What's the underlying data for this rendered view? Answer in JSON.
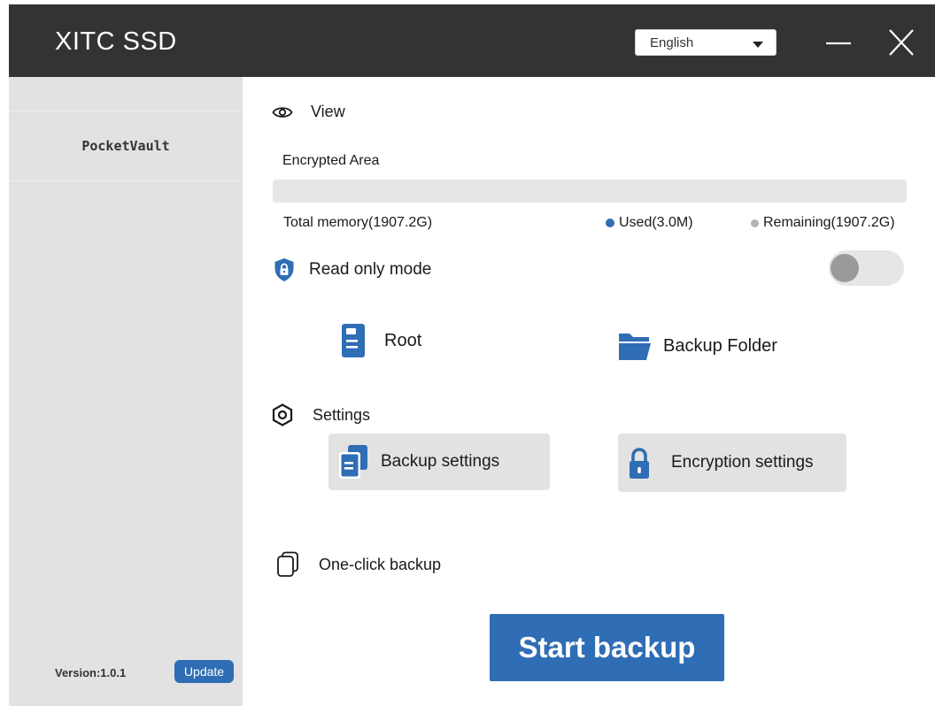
{
  "titlebar": {
    "title": "XITC SSD",
    "language": {
      "selected": "English"
    },
    "minimize_icon": "minimize-icon",
    "close_icon": "close-icon"
  },
  "sidebar": {
    "device_name": "PocketVault",
    "version": "Version:1.0.1",
    "update_label": "Update"
  },
  "view": {
    "heading": "View",
    "icon": "eye-icon",
    "area_label": "Encrypted Area",
    "used_fraction": 1.5e-06,
    "total_memory": "Total memory(1907.2G)",
    "used": "Used(3.0M)",
    "remaining": "Remaining(1907.2G)",
    "read_only_label": "Read only mode",
    "read_only_icon": "shield-lock-icon",
    "read_only_enabled": false,
    "root_label": "Root",
    "root_icon": "document-icon",
    "backup_folder_label": "Backup Folder",
    "backup_folder_icon": "folder-open-icon"
  },
  "settings": {
    "heading": "Settings",
    "icon": "hexagon-settings-icon",
    "backup_settings_label": "Backup settings",
    "backup_settings_icon": "copy-icon",
    "encryption_settings_label": "Encryption settings",
    "encryption_settings_icon": "lock-icon"
  },
  "backup": {
    "one_click_label": "One-click backup",
    "one_click_icon": "copy-outline-icon",
    "start_label": "Start backup"
  },
  "colors": {
    "accent": "#2f6db5",
    "titlebar": "#333333",
    "sidebar": "#e2e2e2",
    "used_dot": "#2f6db5",
    "remaining_dot": "#b3b3b3"
  }
}
